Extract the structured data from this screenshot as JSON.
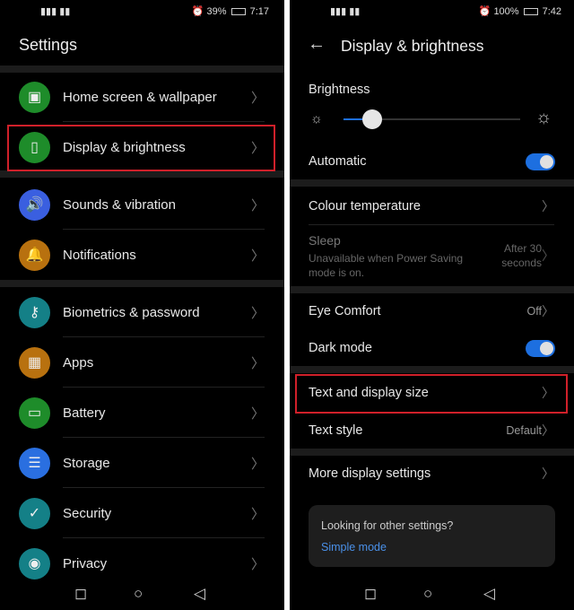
{
  "left": {
    "status": {
      "signal": "signal-icon",
      "alarm": "alarm-icon",
      "battery_pct": "39%",
      "time": "7:17"
    },
    "title": "Settings",
    "groups": [
      [
        {
          "label": "Home screen & wallpaper",
          "icon": "image-icon",
          "color": "#1e8c2a"
        },
        {
          "label": "Display & brightness",
          "icon": "phone-display-icon",
          "color": "#1e8c2a",
          "highlighted": true
        }
      ],
      [
        {
          "label": "Sounds & vibration",
          "icon": "speaker-icon",
          "color": "#3a5fe0"
        },
        {
          "label": "Notifications",
          "icon": "bell-icon",
          "color": "#b8710f"
        }
      ],
      [
        {
          "label": "Biometrics & password",
          "icon": "key-icon",
          "color": "#148087"
        },
        {
          "label": "Apps",
          "icon": "apps-grid-icon",
          "color": "#b8710f"
        },
        {
          "label": "Battery",
          "icon": "battery-icon",
          "color": "#1e8c2a"
        },
        {
          "label": "Storage",
          "icon": "storage-icon",
          "color": "#2a6fe0"
        },
        {
          "label": "Security",
          "icon": "shield-check-icon",
          "color": "#148087"
        },
        {
          "label": "Privacy",
          "icon": "privacy-shield-icon",
          "color": "#148087"
        }
      ]
    ]
  },
  "right": {
    "status": {
      "battery_pct": "100%",
      "time": "7:42"
    },
    "title": "Display & brightness",
    "brightness_label": "Brightness",
    "brightness_level_pct": 16,
    "automatic": {
      "label": "Automatic",
      "on": true
    },
    "colour_temperature": "Colour temperature",
    "sleep": {
      "label": "Sleep",
      "sub": "Unavailable when Power Saving mode is on.",
      "value": "After 30 seconds"
    },
    "eye_comfort": {
      "label": "Eye Comfort",
      "value": "Off"
    },
    "dark_mode": {
      "label": "Dark mode",
      "on": true
    },
    "text_display_size": "Text and display size",
    "text_style": {
      "label": "Text style",
      "value": "Default"
    },
    "more_display": "More display settings",
    "card": {
      "question": "Looking for other settings?",
      "link": "Simple mode"
    }
  },
  "accent": "#1d6fe0",
  "highlight_color": "#d0202a"
}
